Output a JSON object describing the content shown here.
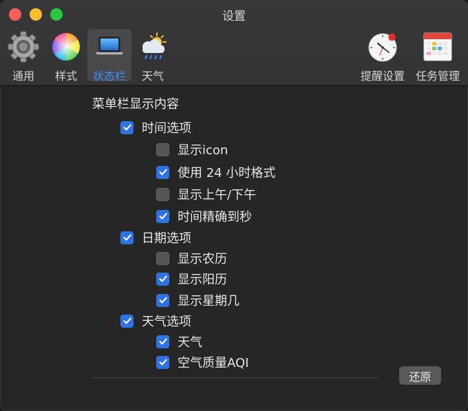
{
  "window": {
    "title": "设置"
  },
  "toolbar": {
    "items": [
      {
        "label": "通用",
        "icon": "gear-icon"
      },
      {
        "label": "样式",
        "icon": "color-wheel-icon"
      },
      {
        "label": "状态栏",
        "icon": "laptop-icon",
        "selected": true
      },
      {
        "label": "天气",
        "icon": "weather-icon"
      },
      {
        "label": "提醒设置",
        "icon": "clock-icon"
      },
      {
        "label": "任务管理",
        "icon": "calendar-icon"
      }
    ]
  },
  "menubar_content": {
    "title": "菜单栏显示内容",
    "groups": [
      {
        "label": "时间选项",
        "checked": true,
        "options": [
          {
            "label": "显示icon",
            "checked": false
          },
          {
            "label": "使用 24 小时格式",
            "checked": true
          },
          {
            "label": "显示上午/下午",
            "checked": false
          },
          {
            "label": "时间精确到秒",
            "checked": true
          }
        ]
      },
      {
        "label": "日期选项",
        "checked": true,
        "options": [
          {
            "label": "显示农历",
            "checked": false
          },
          {
            "label": "显示阳历",
            "checked": true
          },
          {
            "label": "显示星期几",
            "checked": true
          }
        ]
      },
      {
        "label": "天气选项",
        "checked": true,
        "options": [
          {
            "label": "天气",
            "checked": true
          },
          {
            "label": "空气质量AQI",
            "checked": true
          }
        ]
      }
    ]
  },
  "footer": {
    "reset_label": "还原"
  },
  "colors": {
    "accent": "#3d8fff",
    "checkbox_on": "#2f72e4",
    "close": "#ff5f57",
    "minimize": "#febc2e",
    "maximize": "#28c840"
  }
}
